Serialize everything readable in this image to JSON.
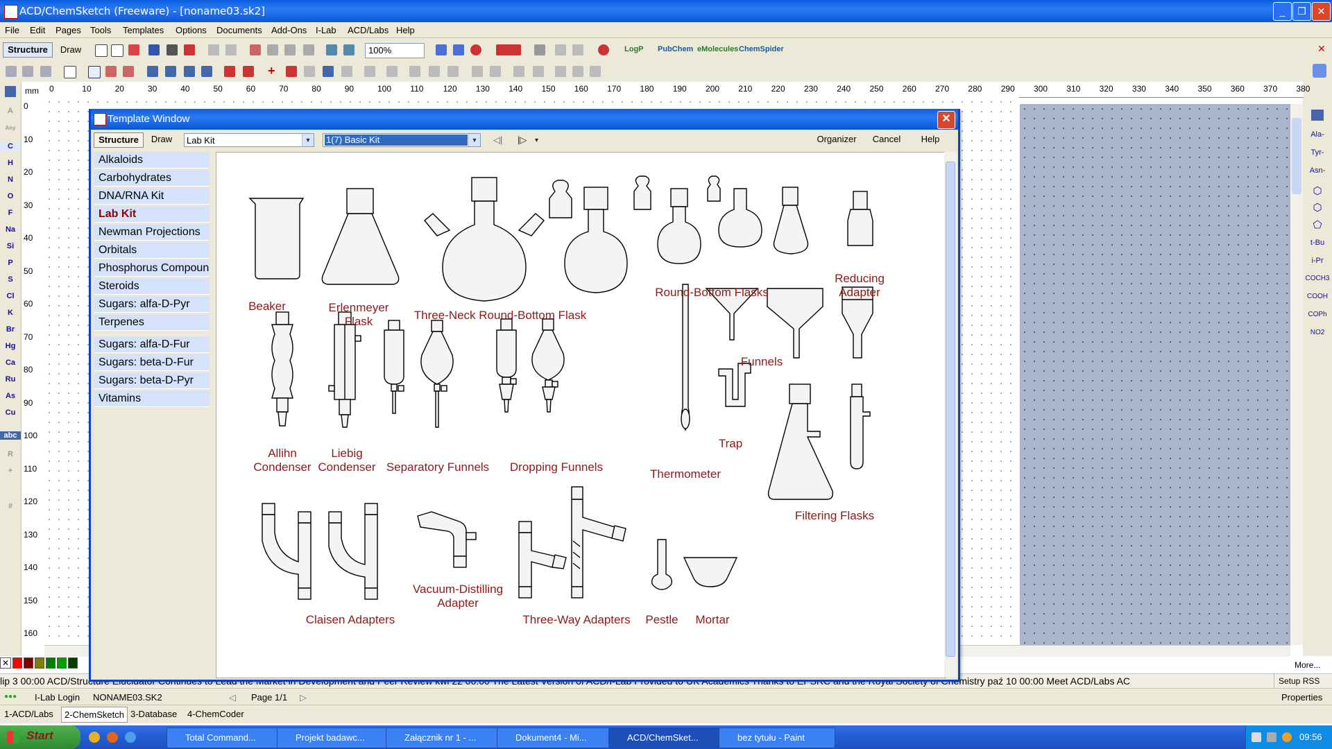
{
  "app": {
    "title": "ACD/ChemSketch (Freeware) - [noname03.sk2]",
    "window_buttons": [
      "_",
      "❐",
      "✕"
    ]
  },
  "menu": [
    "File",
    "Edit",
    "Pages",
    "Tools",
    "Templates",
    "Options",
    "Documents",
    "Add-Ons",
    "I-Lab",
    "ACD/Labs",
    "Help"
  ],
  "toolbar": {
    "mode_structure": "Structure",
    "mode_draw": "Draw",
    "zoom": "100%",
    "links": [
      "LogP",
      "PubChem",
      "eMolecules",
      "ChemSpider"
    ]
  },
  "ruler": {
    "unit": "mm",
    "top": [
      "0",
      "10",
      "20",
      "30",
      "40",
      "50",
      "60",
      "70",
      "80",
      "90",
      "100",
      "110",
      "120",
      "130",
      "140",
      "150",
      "160",
      "170",
      "180",
      "190",
      "200",
      "210",
      "220",
      "230",
      "240",
      "250",
      "260",
      "270",
      "280",
      "290",
      "300",
      "310",
      "320",
      "330",
      "340",
      "350",
      "360",
      "370",
      "380"
    ],
    "left": [
      "0",
      "10",
      "20",
      "30",
      "40",
      "50",
      "60",
      "70",
      "80",
      "90",
      "100",
      "110",
      "120",
      "130",
      "140",
      "150",
      "160"
    ]
  },
  "left_tools": [
    "A",
    "Any",
    "C",
    "H",
    "N",
    "O",
    "F",
    "Na",
    "Si",
    "P",
    "S",
    "Cl",
    "K",
    "Br",
    "Hg",
    "Ca",
    "Ru",
    "As",
    "Cu",
    "abc",
    "R",
    "+",
    "#"
  ],
  "right_tools": [
    "Ala-",
    "Tyr-",
    "Asn-",
    "t-Bu",
    "i-Pr",
    "COCH3",
    "COOH",
    "COPh",
    "NO2"
  ],
  "palette_colors": [
    "#ff0000",
    "#800000",
    "#808000",
    "#008000",
    "#00a000",
    "#004000"
  ],
  "template_window": {
    "title": "Template Window",
    "tab_structure": "Structure",
    "tab_draw": "Draw",
    "category_select": "Lab Kit",
    "page_select": "1(7) Basic Kit",
    "organizer": "Organizer",
    "cancel": "Cancel",
    "help": "Help",
    "categories": [
      "Alkaloids",
      "Carbohydrates",
      "DNA/RNA Kit",
      "Lab Kit",
      "Newman Projections",
      "Orbitals",
      "Phosphorus Compound",
      "Steroids",
      "Sugars: alfa-D-Pyr",
      "Terpenes",
      "Sugars: alfa-D-Fur",
      "Sugars: beta-D-Fur",
      "Sugars: beta-D-Pyr",
      "Vitamins"
    ],
    "selected_category": "Lab Kit",
    "labels": {
      "beaker": "Beaker",
      "erlenmeyer": "Erlenmeyer\nFlask",
      "three_neck": "Three-Neck Round-Bottom Flask",
      "round_bottom": "Round-Bottom Flasks",
      "reducing_adapter": "Reducing\nAdapter",
      "funnels": "Funnels",
      "allihn": "Allihn\nCondenser",
      "liebig": "Liebig\nCondenser",
      "separatory": "Separatory Funnels",
      "dropping": "Dropping Funnels",
      "thermometer": "Thermometer",
      "trap": "Trap",
      "filtering": "Filtering Flasks",
      "claisen": "Claisen Adapters",
      "vacuum": "Vacuum-Distilling\nAdapter",
      "three_way": "Three-Way Adapters",
      "pestle": "Pestle",
      "mortar": "Mortar"
    }
  },
  "ticker": "lip 3 00:00 ACD/Structure Elucidator Continues to Lead the Market in Development and Peer Review  kwi 22 00:00 The Latest Version of ACD/I-Lab Provided to UK Academics Thanks to EPSRC and the Royal Society of Chemistry  paź 10 00:00 Meet ACD/Labs  AC",
  "ticker_more": "More...",
  "ticker_setup": "Setup RSS",
  "status": {
    "ilab": "I-Lab Login",
    "file": "NONAME03.SK2",
    "page": "Page 1/1",
    "properties": "Properties"
  },
  "bottom_tabs": [
    "1-ACD/Labs",
    "2-ChemSketch",
    "3-Database",
    "4-ChemCoder"
  ],
  "taskbar": {
    "start": "Start",
    "tasks": [
      "Total Command...",
      "Projekt badawc...",
      "Załącznik nr 1 - ...",
      "Dokument4 - Mi...",
      "ACD/ChemSket...",
      "bez tytułu - Paint"
    ],
    "active_task": "ACD/ChemSket...",
    "clock": "09:56"
  }
}
